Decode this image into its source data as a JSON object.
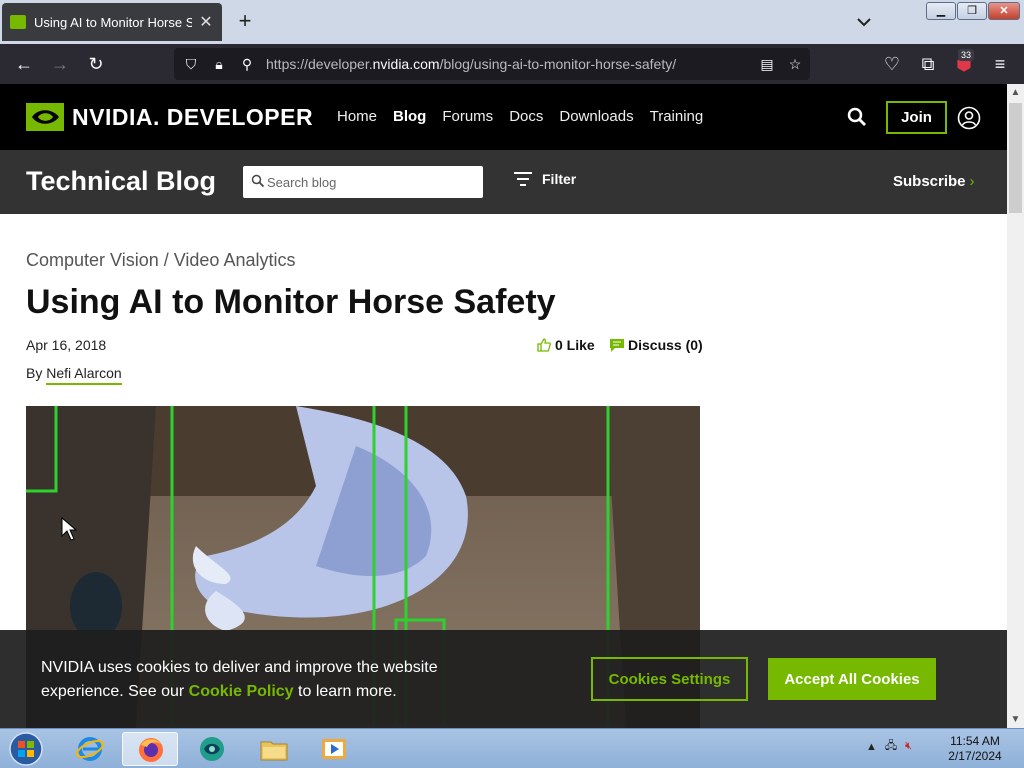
{
  "browser": {
    "tab_title": "Using AI to Monitor Horse Safety",
    "new_tab": "+",
    "url_prefix": "https://developer.",
    "url_domain": "nvidia.com",
    "url_path": "/blog/using-ai-to-monitor-horse-safety/",
    "extension_badge": "33"
  },
  "site": {
    "brand": "NVIDIA. DEVELOPER",
    "nav": [
      "Home",
      "Blog",
      "Forums",
      "Docs",
      "Downloads",
      "Training"
    ],
    "active_nav": "Blog",
    "join_label": "Join",
    "accent_color": "#76b900"
  },
  "blogbar": {
    "title": "Technical Blog",
    "search_placeholder": "Search blog",
    "filter_label": "Filter",
    "subscribe_label": "Subscribe",
    "subscribe_chevron": "›"
  },
  "article": {
    "category": "Computer Vision / Video Analytics",
    "title": "Using AI to Monitor Horse Safety",
    "date": "Apr 16, 2018",
    "byline_prefix": "By",
    "author": "Nefi Alarcon",
    "likes": "0 Like",
    "discuss": "Discuss (0)"
  },
  "cookie": {
    "text_before": "NVIDIA uses cookies to deliver and improve the website experience. See our ",
    "policy_link": "Cookie Policy",
    "text_after": " to learn more.",
    "settings_label": "Cookies Settings",
    "accept_label": "Accept All Cookies"
  },
  "taskbar": {
    "time": "11:54 AM",
    "date": "2/17/2024"
  }
}
